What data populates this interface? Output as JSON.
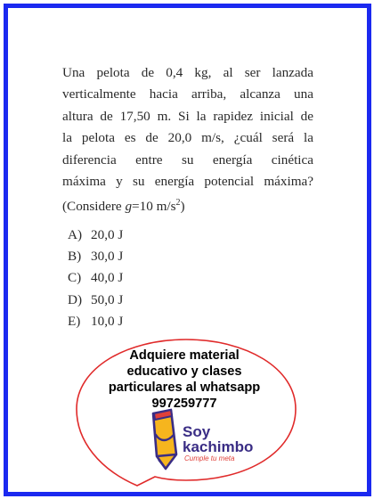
{
  "question": {
    "lines": [
      "Una pelota de 0,4 kg, al ser lanzada",
      "verticalmente hacia arriba, alcanza una",
      "altura de 17,50 m. Si la rapidez inicial de",
      "la pelota es de 20,0 m/s, ¿cuál será la",
      "diferencia entre su energía cinética",
      "máxima y su energía potencial máxima?"
    ],
    "note_prefix": "(Considere ",
    "note_var": "g",
    "note_value": "=10 m/s",
    "note_exp": "2",
    "note_suffix": ")"
  },
  "options": [
    {
      "letter": "A)",
      "text": "20,0 J"
    },
    {
      "letter": "B)",
      "text": "30,0 J"
    },
    {
      "letter": "C)",
      "text": "40,0 J"
    },
    {
      "letter": "D)",
      "text": "50,0 J"
    },
    {
      "letter": "E)",
      "text": "10,0 J"
    }
  ],
  "promo": {
    "lines": [
      "Adquiere material",
      "educativo y clases",
      "particulares al whatsapp",
      "997259777"
    ]
  },
  "logo": {
    "line1": "Soy",
    "line2": "kachimbo",
    "tagline": "Cumple tu meta"
  },
  "colors": {
    "frame_border": "#1b29f0",
    "bubble_outline": "#e02a2a",
    "logo_text": "#3a2d85",
    "logo_accent": "#e0403a",
    "pencil_body": "#f6b51e"
  }
}
